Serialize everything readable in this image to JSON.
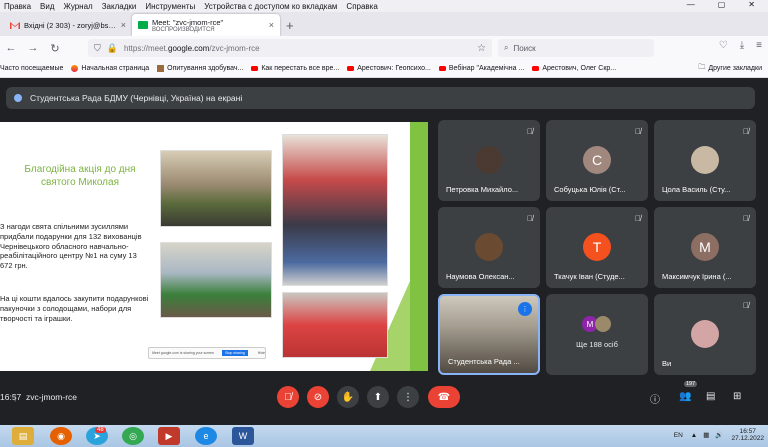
{
  "menu": [
    "Правка",
    "Вид",
    "Журнал",
    "Закладки",
    "Инструменты",
    "Устройства с доступом ко вкладкам",
    "Справка"
  ],
  "tabs": [
    {
      "title": "Вхідні (2 303) - zoryj@bsmu.edu.ua",
      "close": "×"
    },
    {
      "title": "Meet: \"zvc-jmom-rce\"",
      "subtitle": "ВОСПРОИЗВОДИТСЯ",
      "close": "×"
    }
  ],
  "new_tab": "+",
  "address": {
    "prefix": "https://meet.",
    "host": "google.com",
    "path": "/zvc-jmom-rce"
  },
  "search_placeholder": "Поиск",
  "bookmarks": [
    {
      "label": "Часто посещаемые",
      "icon": "none"
    },
    {
      "label": "Начальная страница",
      "icon": "firefox"
    },
    {
      "label": "Опитування здобувач...",
      "icon": "photo"
    },
    {
      "label": "Как перестать все вре...",
      "icon": "youtube"
    },
    {
      "label": "Арестович: Геопсихо...",
      "icon": "youtube"
    },
    {
      "label": "Вебінар \"Академічна ...",
      "icon": "youtube"
    },
    {
      "label": "Арестович, Олег Скр...",
      "icon": "youtube"
    }
  ],
  "other_bookmarks": "Другие закладки",
  "banner": "Студентська Рада БДМУ (Чернівці, Україна) на екрані",
  "slide": {
    "title": "Благодійна акція до дня святого Миколая",
    "para1": "З нагоди свята спільними зусиллями придбали подарунки для 132 вихованців Чернівецького обласного навчально-реабілітаційного центру №1 на суму 13 672 грн.",
    "para2": "На ці кошти вдалось закупити подарункові пакуночки з солодощами, набори для творчості та іграшки.",
    "shot_text": "Meet google.com is sharing your screen",
    "shot_btn": "Stop sharing",
    "shot_hide": "Hide"
  },
  "participants": [
    {
      "name": "Петровка Михайло...",
      "avatar": "photo",
      "color": "#4a3a32",
      "muted": true
    },
    {
      "name": "Собуцька Юлія (Ст...",
      "avatar": "С",
      "color": "#a1887f",
      "muted": true
    },
    {
      "name": "Цола Василь (Сту...",
      "avatar": "photo",
      "color": "#c9b8a3",
      "muted": true
    },
    {
      "name": "Наумова Олексан...",
      "avatar": "photo",
      "color": "#6b4a32",
      "muted": true
    },
    {
      "name": "Ткачук Іван (Студе...",
      "avatar": "Т",
      "color": "#f4511e",
      "muted": true
    },
    {
      "name": "Максимчук Ірина (...",
      "avatar": "М",
      "color": "#8d6e63",
      "muted": true
    },
    {
      "name": "Студентська Рада ...",
      "avatar": "camera",
      "color": "#8a8070",
      "muted": false
    },
    {
      "name": "",
      "avatar": "more",
      "color": "#3c4043",
      "muted": false
    },
    {
      "name": "Ви",
      "avatar": "photo",
      "color": "#d4a5a5",
      "muted": true
    }
  ],
  "more_people": "Ще 188 осіб",
  "more_avatars": [
    "М",
    "photo"
  ],
  "bottom": {
    "time": "16:57",
    "sep": "|",
    "code": "zvc-jmom-rce",
    "participants_count": "197"
  },
  "taskbar": {
    "lang": "EN",
    "time": "16:57",
    "date": "27.12.2022",
    "telegram_badge": "48"
  },
  "colors": {
    "meet_bg": "#202124",
    "tile_bg": "#3c4043",
    "accent_red": "#ea4335",
    "slide_green": "#80c342",
    "active_speaker": "#8ab4f8"
  }
}
